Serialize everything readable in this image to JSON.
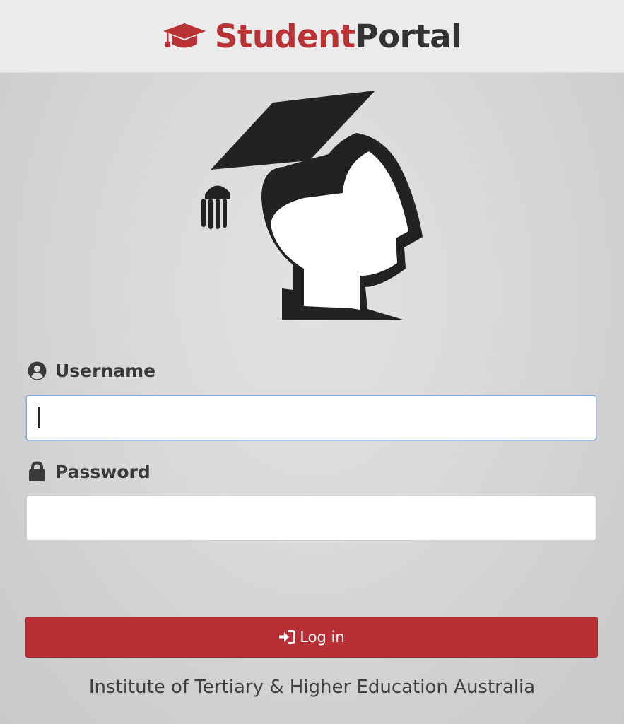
{
  "brand": {
    "name_part1": "Student",
    "name_part2": "Portal",
    "icon": "graduation-cap-icon",
    "accent_color": "#b83236"
  },
  "hero": {
    "icon": "student-graduate-illustration"
  },
  "form": {
    "username": {
      "label": "Username",
      "icon": "user-circle-icon",
      "value": ""
    },
    "password": {
      "label": "Password",
      "icon": "lock-icon",
      "value": ""
    },
    "login_button": {
      "label": "Log in",
      "icon": "sign-in-icon",
      "color": "#b83035"
    }
  },
  "footer": {
    "text": "Institute of Tertiary & Higher Education Australia"
  }
}
